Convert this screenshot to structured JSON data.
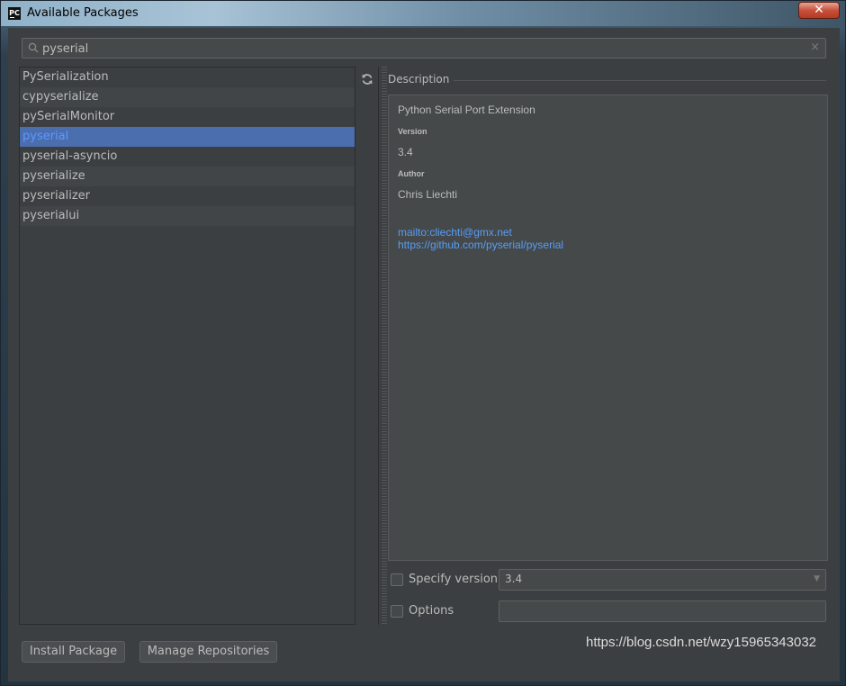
{
  "window": {
    "title": "Available Packages",
    "app_icon_text": "PC",
    "close_symbol": "✕"
  },
  "search": {
    "value": "pyserial",
    "clear_symbol": "×"
  },
  "packages": [
    "PySerialization",
    "cypyserialize",
    "pySerialMonitor",
    "pyserial",
    "pyserial-asyncio",
    "pyserialize",
    "pyserializer",
    "pyserialui"
  ],
  "selected_package": "pyserial",
  "description": {
    "label": "Description",
    "summary": "Python Serial Port Extension",
    "version_heading": "Version",
    "version": "3.4",
    "author_heading": "Author",
    "author": "Chris Liechti",
    "email_link": "mailto:cliechti@gmx.net",
    "project_link": "https://github.com/pyserial/pyserial"
  },
  "options": {
    "specify_version_label": "Specify version",
    "specify_version_value": "3.4",
    "options_label": "Options",
    "options_value": ""
  },
  "buttons": {
    "install": "Install Package",
    "manage": "Manage Repositories"
  },
  "watermark": "https://blog.csdn.net/wzy15965343032",
  "colors": {
    "background": "#3c3f41",
    "selection": "#4b6eaf",
    "selected_text": "#5c98ff",
    "link": "#589df6"
  }
}
